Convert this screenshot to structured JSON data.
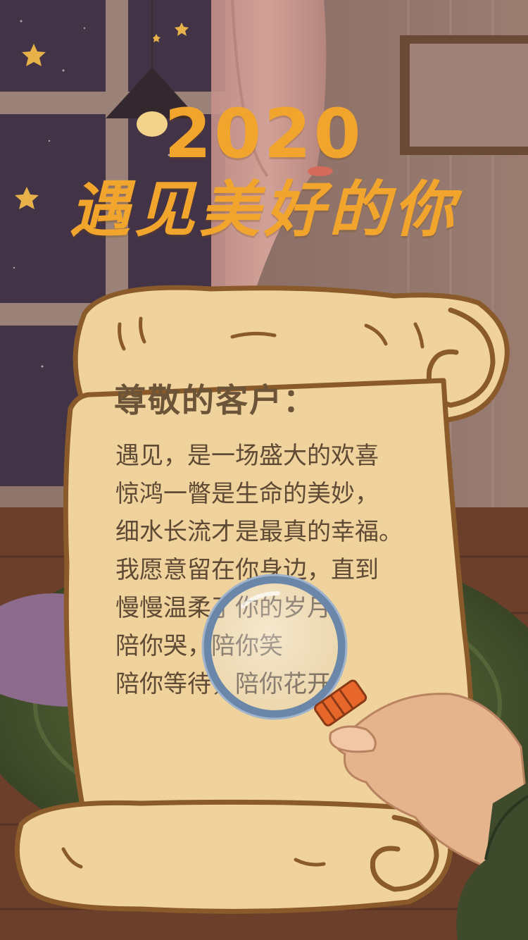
{
  "title": {
    "year": "2020",
    "headline": "遇见美好的你"
  },
  "letter": {
    "greeting": "尊敬的客户：",
    "lines": [
      "遇见，是一场盛大的欢喜",
      "惊鸿一瞥是生命的美妙，",
      "细水长流才是最真的幸福。",
      "我愿意留在你身边，直到",
      "慢慢温柔了你的岁月",
      "陪你哭，陪你笑",
      "陪你等待，陪你花开"
    ]
  },
  "colors": {
    "title": "#f2a52c",
    "scroll_paper": "#f0d39c",
    "scroll_outline": "#8a5a2b",
    "wall": "#8b6d66",
    "night_sky": "#4a3a4f",
    "text": "#5e4a35"
  },
  "icons": {
    "lamp": "pendant-lamp-icon",
    "star": "star-icon",
    "magnifier": "magnifying-glass-icon",
    "hand": "hand-illustration"
  }
}
